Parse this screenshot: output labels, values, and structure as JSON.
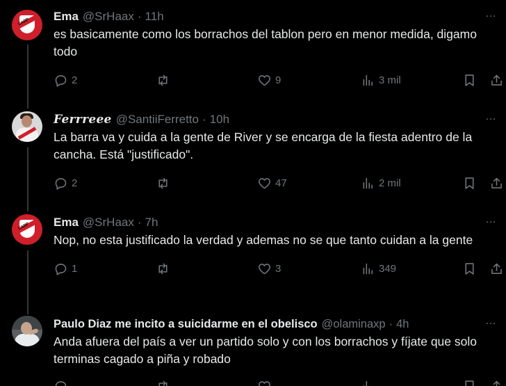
{
  "tweets": [
    {
      "name": "Ema",
      "handle": "@SrHaax",
      "separator": "·",
      "time": "11h",
      "avatar": "river-plate-logo",
      "text": "es basicamente como los borrachos del tablon pero en menor medida, digamo todo",
      "replies": "2",
      "retweets": "",
      "likes": "9",
      "views": "3 mil"
    },
    {
      "name": "Ferrreee",
      "handle": "@SantiiFerretto",
      "separator": "·",
      "time": "10h",
      "avatar": "user-photo",
      "text": "La barra va y cuida a la gente de River y se encarga de la fiesta adentro de la cancha. Está \"justificado\".",
      "replies": "2",
      "retweets": "",
      "likes": "47",
      "views": "2 mil"
    },
    {
      "name": "Ema",
      "handle": "@SrHaax",
      "separator": "·",
      "time": "7h",
      "avatar": "river-plate-logo",
      "text": "Nop, no esta justificado la verdad y ademas no se que tanto cuidan a la gente",
      "replies": "1",
      "retweets": "",
      "likes": "3",
      "views": "349"
    },
    {
      "name": "Paulo Diaz me incito a suicidarme en el obelisco",
      "handle": "@olaminaxp",
      "separator": "·",
      "time": "4h",
      "avatar": "user-photo",
      "text": "Anda afuera del país a ver un partido solo y con los borrachos y fíjate que solo terminas cagado a piña y robado"
    }
  ],
  "more_icon": "…",
  "colors": {
    "background": "#000000",
    "text": "#e7e9ea",
    "muted": "#71767b",
    "thread_line": "#333639",
    "river_red": "#cf1f2a"
  },
  "icons": [
    "reply-icon",
    "retweet-icon",
    "like-icon",
    "views-icon",
    "bookmark-icon",
    "share-icon",
    "more-icon"
  ]
}
